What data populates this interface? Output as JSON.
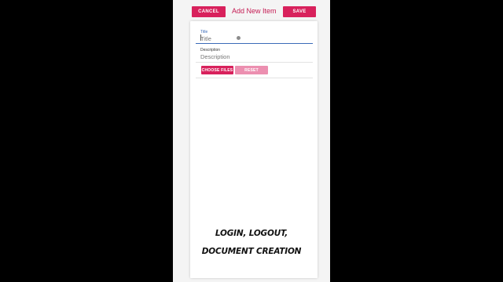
{
  "header": {
    "cancel_label": "CANCEL",
    "title": "Add New Item",
    "save_label": "SAVE"
  },
  "form": {
    "title_label": "Title",
    "title_placeholder": "Title",
    "description_label": "Description",
    "description_placeholder": "Description",
    "choose_files_label": "CHOOSE FILES",
    "reset_label": "RESET"
  },
  "caption": {
    "line1": "LOGIN, LOGOUT,",
    "line2": "DOCUMENT CREATION"
  },
  "colors": {
    "accent": "#d8215c",
    "accent_light": "#ec8fb0",
    "focus_blue": "#3a6bb8"
  }
}
